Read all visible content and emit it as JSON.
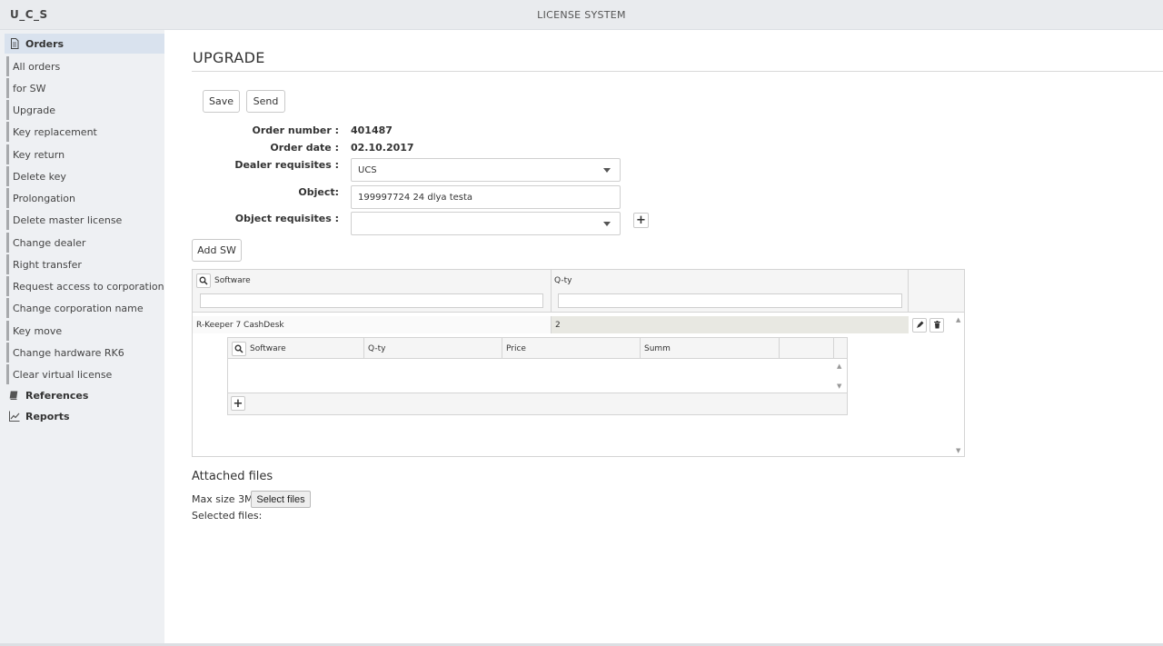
{
  "header": {
    "brand": "U_C_S",
    "title": "LICENSE SYSTEM"
  },
  "sidebar": {
    "sections": [
      {
        "label": "Orders",
        "icon": "document-icon",
        "active": true
      },
      {
        "label": "References",
        "icon": "book-icon",
        "active": false
      },
      {
        "label": "Reports",
        "icon": "chart-line-icon",
        "active": false
      }
    ],
    "items": [
      {
        "label": "All orders"
      },
      {
        "label": "for SW"
      },
      {
        "label": "Upgrade"
      },
      {
        "label": "Key replacement"
      },
      {
        "label": "Key return"
      },
      {
        "label": "Delete key"
      },
      {
        "label": "Prolongation"
      },
      {
        "label": "Delete master license"
      },
      {
        "label": "Change dealer"
      },
      {
        "label": "Right transfer"
      },
      {
        "label": "Request access to corporation"
      },
      {
        "label": "Change corporation name"
      },
      {
        "label": "Key move"
      },
      {
        "label": "Change hardware RK6"
      },
      {
        "label": "Clear virtual license"
      }
    ]
  },
  "main": {
    "title": "UPGRADE",
    "toolbar": {
      "save_label": "Save",
      "send_label": "Send"
    },
    "form": {
      "order_number_label": "Order number :",
      "order_number": "401487",
      "order_date_label": "Order date :",
      "order_date": "02.10.2017",
      "dealer_label": "Dealer requisites :",
      "dealer_value": "UCS",
      "object_label": "Object:",
      "object_value": "199997724 24 dlya testa",
      "object_requisites_label": "Object requisites :",
      "object_requisites_value": ""
    },
    "add_sw_label": "Add SW",
    "grid": {
      "columns": [
        "Software",
        "Q-ty"
      ],
      "rows": [
        {
          "software": "R-Keeper 7 CashDesk",
          "qty": "2"
        }
      ]
    },
    "subgrid": {
      "columns": [
        "Software",
        "Q-ty",
        "Price",
        "Summ"
      ],
      "rows": []
    },
    "attachments": {
      "title": "Attached files",
      "max_size_label": "Max size 3Mb",
      "select_label": "Select files",
      "selected_label": "Selected files:"
    }
  }
}
